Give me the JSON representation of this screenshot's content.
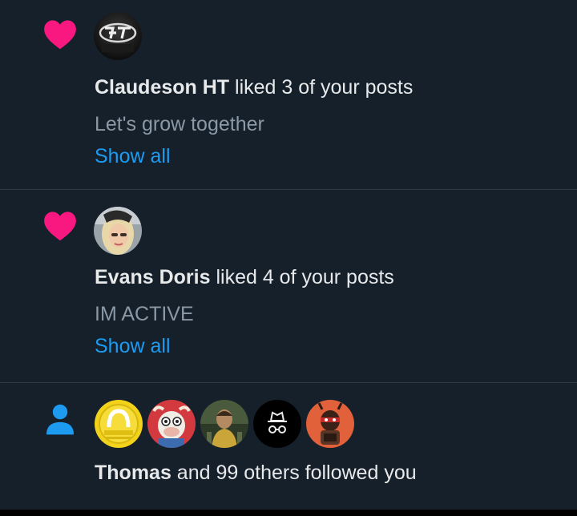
{
  "notifications": [
    {
      "type": "like",
      "icon": "heart-icon",
      "user": "Claudeson HT",
      "action": " liked 3 of your posts",
      "post_preview": "Let's grow together",
      "link": "Show all"
    },
    {
      "type": "like",
      "icon": "heart-icon",
      "user": "Evans Doris",
      "action": " liked 4 of your posts",
      "post_preview": "IM ACTIVE",
      "link": "Show all"
    },
    {
      "type": "follow",
      "icon": "person-icon",
      "user": "Thomas",
      "action": " and 99 others followed you"
    }
  ],
  "colors": {
    "background": "#15202b",
    "heart": "#f91880",
    "link": "#1d9bf0",
    "secondary_text": "#8b98a5",
    "follow_icon": "#1d9bf0"
  }
}
